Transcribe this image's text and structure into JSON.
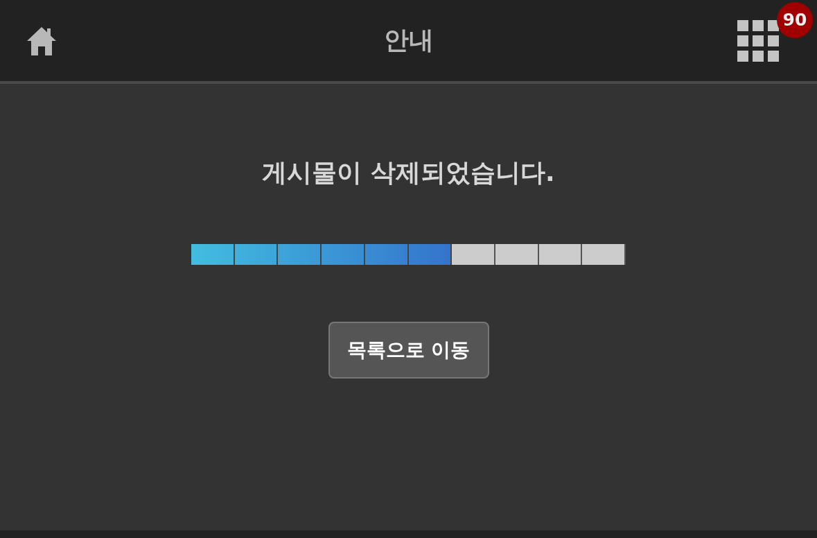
{
  "header": {
    "title": "안내",
    "badge": "90"
  },
  "message": "게시물이 삭제되었습니다.",
  "progress": {
    "level": 0.6
  },
  "button": "목록으로 이동"
}
